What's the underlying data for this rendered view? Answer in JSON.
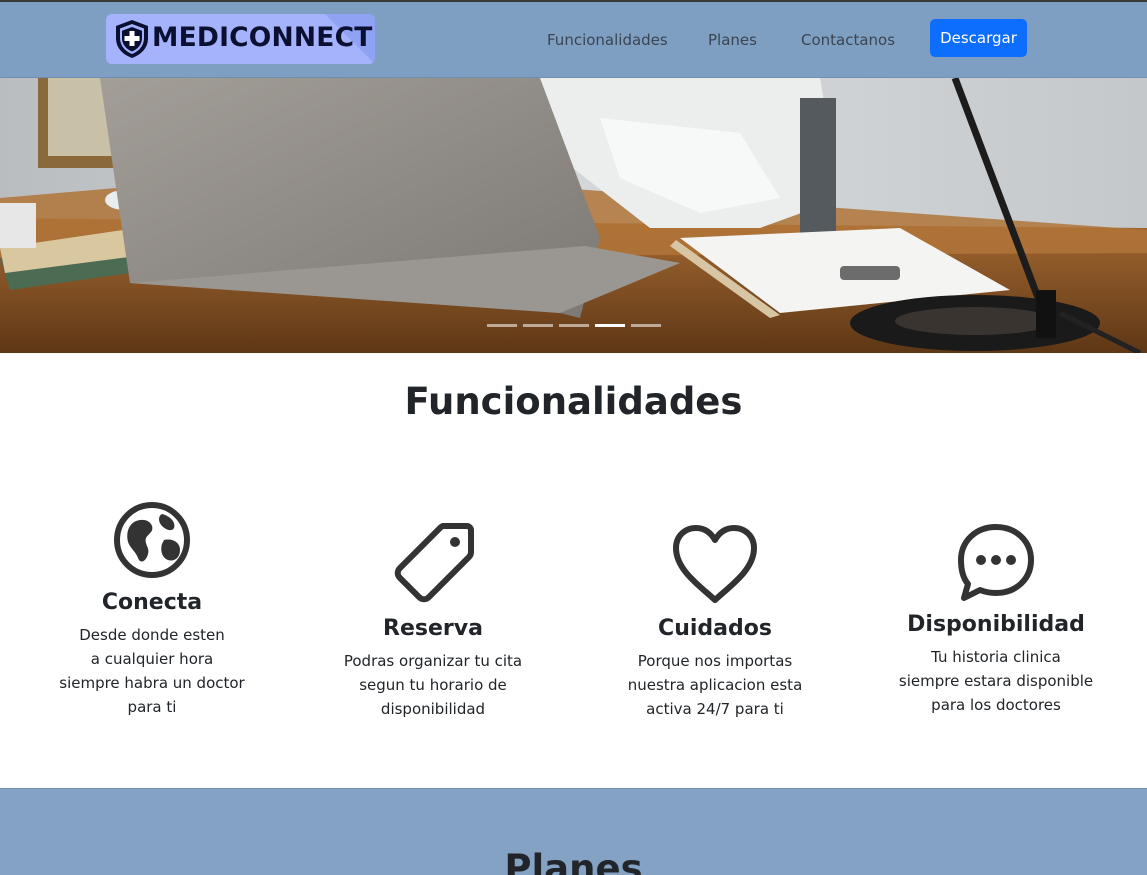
{
  "navbar": {
    "brand": "MEDICONNECT",
    "links": [
      "Funcionalidades",
      "Planes",
      "Contactanos"
    ],
    "cta_label": "Descargar"
  },
  "hero": {
    "slide_count": 5,
    "active_slide": 4
  },
  "features": {
    "title": "Funcionalidades",
    "items": [
      {
        "icon": "globe-icon",
        "title": "Conecta",
        "text": "Desde donde esten\na cualquier hora\nsiempre habra un doctor\npara ti"
      },
      {
        "icon": "tag-icon",
        "title": "Reserva",
        "text": "Podras organizar tu cita\nsegun tu horario de\ndisponibilidad"
      },
      {
        "icon": "heart-icon",
        "title": "Cuidados",
        "text": "Porque nos importas\nnuestra aplicacion esta\nactiva 24/7 para ti"
      },
      {
        "icon": "chat-dots-icon",
        "title": "Disponibilidad",
        "text": "Tu historia clinica\nsiempre estara disponible\npara los doctores"
      }
    ]
  },
  "planes": {
    "title": "Planes"
  },
  "colors": {
    "navbar_bg": "#7f9fc2",
    "cta_bg": "#0d6efd",
    "planes_bg": "#84a2c4"
  }
}
